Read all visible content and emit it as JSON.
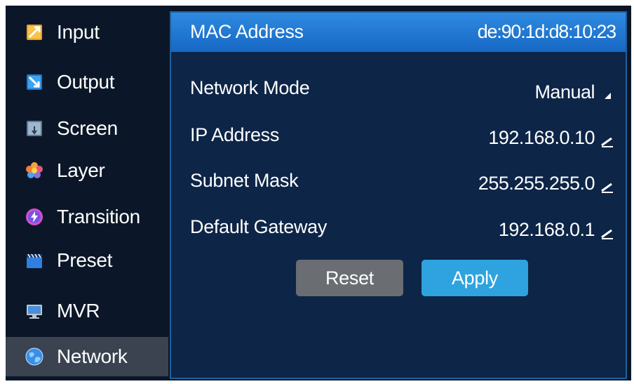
{
  "sidebar": {
    "items": [
      {
        "label": "Input",
        "icon": "input-icon"
      },
      {
        "label": "Output",
        "icon": "output-icon"
      },
      {
        "label": "Screen",
        "icon": "screen-icon"
      },
      {
        "label": "Layer",
        "icon": "layer-icon"
      },
      {
        "label": "Transition",
        "icon": "transition-icon"
      },
      {
        "label": "Preset",
        "icon": "preset-icon"
      },
      {
        "label": "MVR",
        "icon": "mvr-icon"
      },
      {
        "label": "Network",
        "icon": "network-icon",
        "active": true
      }
    ]
  },
  "network": {
    "mac": {
      "label": "MAC Address",
      "value": "de:90:1d:d8:10:23"
    },
    "mode": {
      "label": "Network Mode",
      "value": "Manual"
    },
    "ip": {
      "label": "IP Address",
      "value": "192.168.0.10"
    },
    "subnet": {
      "label": "Subnet Mask",
      "value": "255.255.255.0"
    },
    "gateway": {
      "label": "Default Gateway",
      "value": "192.168.0.1"
    }
  },
  "buttons": {
    "reset": "Reset",
    "apply": "Apply"
  },
  "colors": {
    "background": "#0a1627",
    "panel": "#0d2547",
    "panel_border": "#1e5f9e",
    "highlight": "#1f78d2",
    "active_sidebar": "#3b4350",
    "reset_button": "#6a6d72",
    "apply_button": "#2ea3df"
  }
}
